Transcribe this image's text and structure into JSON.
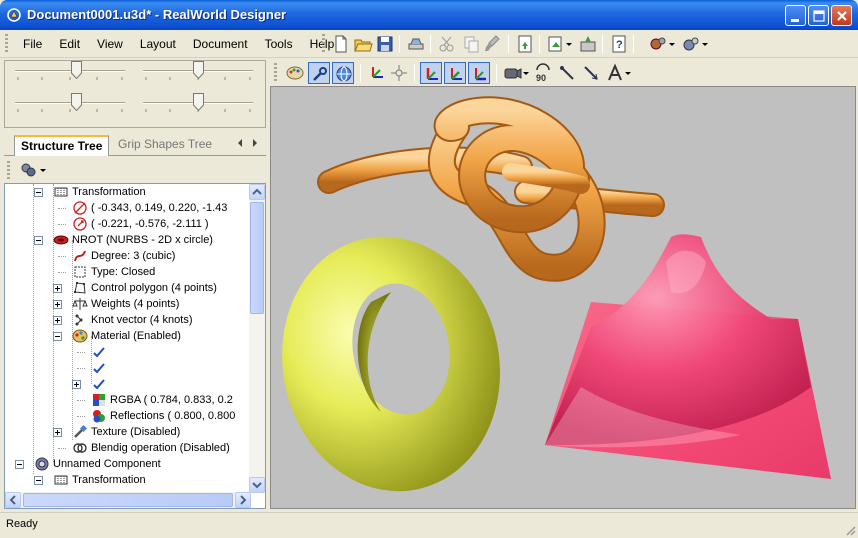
{
  "window": {
    "title": "Document0001.u3d* - RealWorld Designer"
  },
  "menu": [
    "File",
    "Edit",
    "View",
    "Layout",
    "Document",
    "Tools",
    "Help"
  ],
  "tabs": {
    "active": "Structure Tree",
    "inactive": "Grip Shapes Tree"
  },
  "tree": [
    {
      "label": "Transformation",
      "indent": 2,
      "expander": "minus",
      "icon": "transformation-icon"
    },
    {
      "label": "( -0.343, 0.149, 0.220, -1.43",
      "indent": 3,
      "expander": "none",
      "icon": "rotation-icon"
    },
    {
      "label": "( -0.221, -0.576, -2.111 )",
      "indent": 3,
      "expander": "none",
      "icon": "translation-icon"
    },
    {
      "label": "NROT (NURBS - 2D x circle)",
      "indent": 2,
      "expander": "minus",
      "icon": "nurbs-icon"
    },
    {
      "label": "Degree: 3 (cubic)",
      "indent": 3,
      "expander": "none",
      "icon": "degree-icon"
    },
    {
      "label": "Type: Closed",
      "indent": 3,
      "expander": "none",
      "icon": "closed-type-icon"
    },
    {
      "label": "Control polygon (4 points)",
      "indent": 3,
      "expander": "plus",
      "icon": "control-polygon-icon"
    },
    {
      "label": "Weights (4 points)",
      "indent": 3,
      "expander": "plus",
      "icon": "weights-icon"
    },
    {
      "label": "Knot vector (4 knots)",
      "indent": 3,
      "expander": "plus",
      "icon": "knot-vector-icon"
    },
    {
      "label": "Material (Enabled)",
      "indent": 3,
      "expander": "minus",
      "icon": "material-icon"
    },
    {
      "label": "",
      "indent": 4,
      "expander": "none",
      "icon": "check-icon"
    },
    {
      "label": "",
      "indent": 4,
      "expander": "none",
      "icon": "check-icon"
    },
    {
      "label": "",
      "indent": 4,
      "expander": "plus",
      "icon": "check-icon"
    },
    {
      "label": "RGBA ( 0.784, 0.833, 0.2",
      "indent": 4,
      "expander": "none",
      "icon": "rgba-icon"
    },
    {
      "label": "Reflections ( 0.800, 0.800",
      "indent": 4,
      "expander": "none",
      "icon": "reflections-icon"
    },
    {
      "label": "Texture (Disabled)",
      "indent": 3,
      "expander": "plus",
      "icon": "texture-icon"
    },
    {
      "label": "Blendig operation (Disabled)",
      "indent": 3,
      "expander": "none",
      "icon": "blending-icon"
    },
    {
      "label": "Unnamed Component",
      "indent": 1,
      "expander": "minus",
      "icon": "component-icon"
    },
    {
      "label": "Transformation",
      "indent": 2,
      "expander": "minus",
      "icon": "transformation-icon"
    }
  ],
  "status": {
    "text": "Ready"
  },
  "colors": {
    "knot": "#f0a040",
    "torus": "#e8ee60",
    "surface": "#f04878",
    "viewport_bg": "#c0c0c0"
  }
}
